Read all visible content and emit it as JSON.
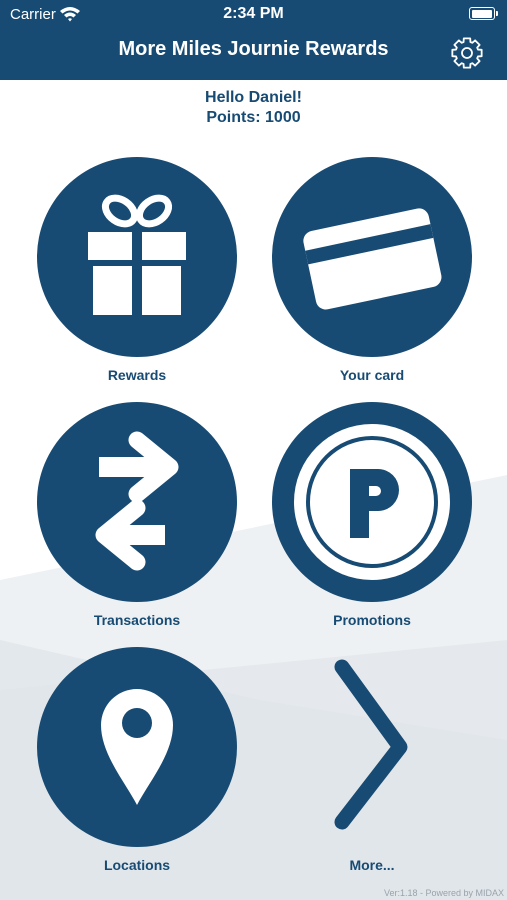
{
  "status_bar": {
    "carrier": "Carrier",
    "time": "2:34 PM",
    "battery_level": 1.0
  },
  "header": {
    "title": "More Miles Journie Rewards",
    "settings_icon": "gear-icon"
  },
  "greeting": {
    "hello": "Hello Daniel!",
    "points": "Points: 1000"
  },
  "tiles": [
    {
      "label": "Rewards",
      "icon": "gift-icon"
    },
    {
      "label": "Your card",
      "icon": "credit-card-icon"
    },
    {
      "label": "Transactions",
      "icon": "exchange-arrows-icon"
    },
    {
      "label": "Promotions",
      "icon": "promotions-p-icon"
    },
    {
      "label": "Locations",
      "icon": "map-pin-icon"
    },
    {
      "label": "More...",
      "icon": "chevron-right-icon"
    }
  ],
  "footer": {
    "version": "Ver:1.18 - Powered by MIDAX"
  },
  "colors": {
    "primary": "#184b73",
    "background_light": "#e9edf0",
    "background_mid": "#dde3e8"
  }
}
